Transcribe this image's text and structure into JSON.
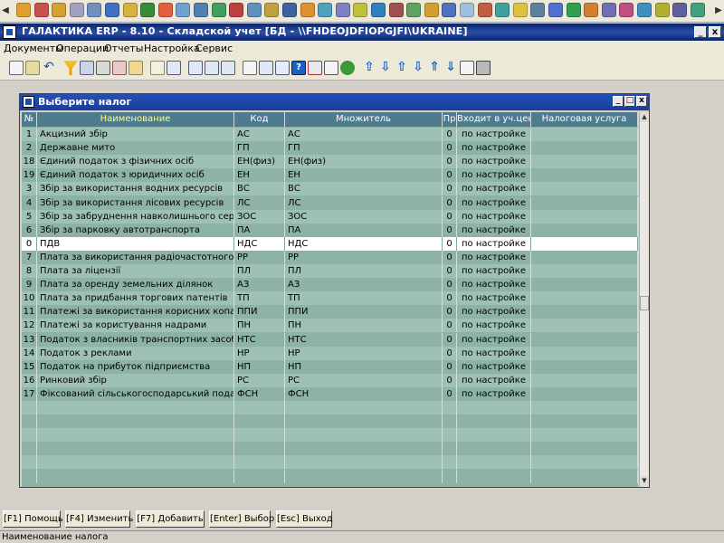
{
  "window": {
    "title": "ГАЛАКТИКА ERP - 8.10 - Складской учет [БД - \\\\FHDEOJDFIOPGJFI\\UKRAINE]",
    "min_label": "_",
    "close_label": "x"
  },
  "menu": {
    "items": [
      "Документы",
      "Операции",
      "Отчеты",
      "Настройка",
      "Сервис"
    ]
  },
  "dialog": {
    "title": "Выберите налог"
  },
  "grid": {
    "headers": {
      "num": "№",
      "name": "Наименование",
      "code": "Код",
      "multiplier": "Множитель",
      "pr": "Пр",
      "in_price": "Входит в уч.цену",
      "service": "Налоговая услуга"
    },
    "rows": [
      {
        "num": "1",
        "name": "Акцизний збір",
        "code": "АС",
        "multiplier": "АС",
        "pr": "0",
        "in_price": "по настройке",
        "service": ""
      },
      {
        "num": "2",
        "name": "Державне мито",
        "code": "ГП",
        "multiplier": "ГП",
        "pr": "0",
        "in_price": "по настройке",
        "service": ""
      },
      {
        "num": "18",
        "name": "Єдиний податок з фізичних осіб",
        "code": "ЕН(физ)",
        "multiplier": "ЕН(физ)",
        "pr": "0",
        "in_price": "по настройке",
        "service": ""
      },
      {
        "num": "19",
        "name": "Єдиний податок з юридичних осіб",
        "code": "ЕН",
        "multiplier": "ЕН",
        "pr": "0",
        "in_price": "по настройке",
        "service": ""
      },
      {
        "num": "3",
        "name": "Збір за використання водних ресурсів",
        "code": "ВС",
        "multiplier": "ВС",
        "pr": "0",
        "in_price": "по настройке",
        "service": ""
      },
      {
        "num": "4",
        "name": "Збір за використання лісових ресурсів",
        "code": "ЛС",
        "multiplier": "ЛС",
        "pr": "0",
        "in_price": "по настройке",
        "service": ""
      },
      {
        "num": "5",
        "name": "Збір за забруднення навколишнього середовища",
        "code": "ЗОС",
        "multiplier": "ЗОС",
        "pr": "0",
        "in_price": "по настройке",
        "service": ""
      },
      {
        "num": "6",
        "name": "Збір за парковку автотранспорта",
        "code": "ПА",
        "multiplier": "ПА",
        "pr": "0",
        "in_price": "по настройке",
        "service": ""
      },
      {
        "num": "0",
        "name": "ПДВ",
        "code": "НДС",
        "multiplier": "НДС",
        "pr": "0",
        "in_price": "по настройке",
        "service": ""
      },
      {
        "num": "7",
        "name": "Плата за використання радіочастотного ресурсу",
        "code": "РР",
        "multiplier": "РР",
        "pr": "0",
        "in_price": "по настройке",
        "service": ""
      },
      {
        "num": "8",
        "name": "Плата за ліцензії",
        "code": "ПЛ",
        "multiplier": "ПЛ",
        "pr": "0",
        "in_price": "по настройке",
        "service": ""
      },
      {
        "num": "9",
        "name": "Плата за оренду земельних ділянок",
        "code": "АЗ",
        "multiplier": "АЗ",
        "pr": "0",
        "in_price": "по настройке",
        "service": ""
      },
      {
        "num": "10",
        "name": "Плата за придбання торгових патентів",
        "code": "ТП",
        "multiplier": "ТП",
        "pr": "0",
        "in_price": "по настройке",
        "service": ""
      },
      {
        "num": "11",
        "name": "Платежі за використання корисних копалин",
        "code": "ППИ",
        "multiplier": "ППИ",
        "pr": "0",
        "in_price": "по настройке",
        "service": ""
      },
      {
        "num": "12",
        "name": "Платежі за користування надрами",
        "code": "ПН",
        "multiplier": "ПН",
        "pr": "0",
        "in_price": "по настройке",
        "service": ""
      },
      {
        "num": "13",
        "name": "Податок з власників транспортних засобів",
        "code": "НТС",
        "multiplier": "НТС",
        "pr": "0",
        "in_price": "по настройке",
        "service": ""
      },
      {
        "num": "14",
        "name": "Податок з реклами",
        "code": "НР",
        "multiplier": "НР",
        "pr": "0",
        "in_price": "по настройке",
        "service": ""
      },
      {
        "num": "15",
        "name": "Податок на прибуток підприємства",
        "code": "НП",
        "multiplier": "НП",
        "pr": "0",
        "in_price": "по настройке",
        "service": ""
      },
      {
        "num": "16",
        "name": "Ринковий збір",
        "code": "РС",
        "multiplier": "РС",
        "pr": "0",
        "in_price": "по настройке",
        "service": ""
      },
      {
        "num": "17",
        "name": "Фіксований сільськогосподарський податок",
        "code": "ФСН",
        "multiplier": "ФСН",
        "pr": "0",
        "in_price": "по настройке",
        "service": ""
      }
    ],
    "selected_index": 8
  },
  "bottom_buttons": [
    "[F1] Помощь",
    "[F4] Изменить",
    "[F7] Добавить",
    "[Enter] Выбор",
    "[Esc] Выход"
  ],
  "status": "Наименование налога",
  "colors": {
    "grid_header": "#4f7b8e",
    "grid_row": "#8db2a6",
    "grid_row_alt": "#9fc0b5",
    "selected_row": "#ffffff",
    "title_bar": "#0a246a"
  }
}
